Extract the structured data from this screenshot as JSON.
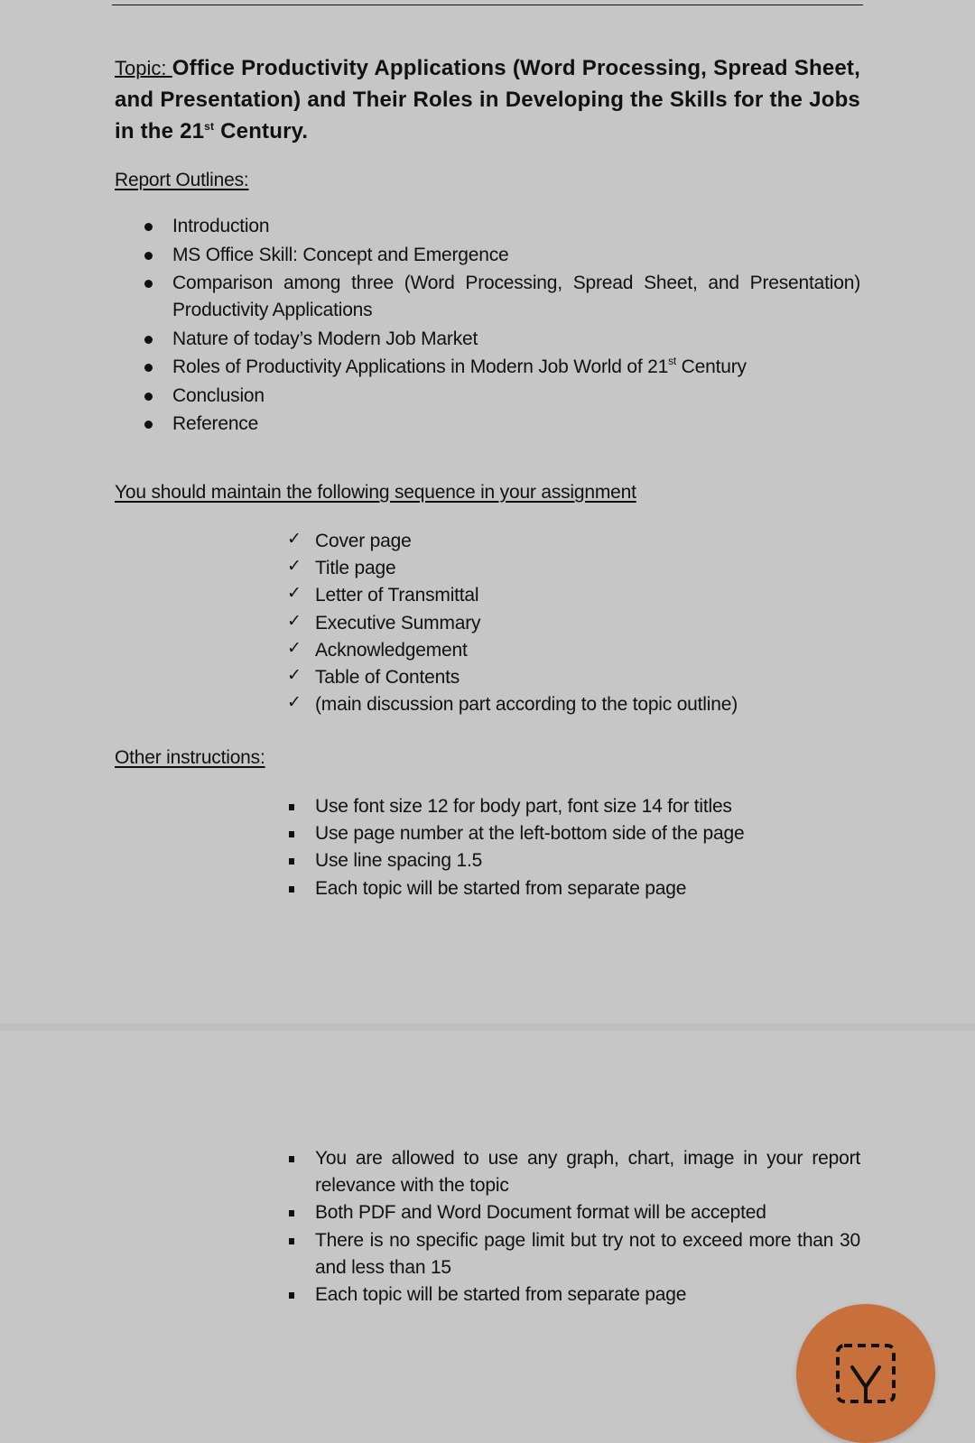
{
  "document": {
    "topic": {
      "label": "Topic: ",
      "title_pre": "Office Productivity Applications (Word Processing, Spread Sheet, and Presentation) and Their Roles in Developing the Skills for the Jobs in the 21",
      "title_sup": "st",
      "title_post": " Century."
    },
    "report_outlines": {
      "heading": "Report Outlines:",
      "items": [
        {
          "text": "Introduction"
        },
        {
          "text": "MS Office Skill: Concept and Emergence"
        },
        {
          "text": "Comparison among three (Word Processing, Spread Sheet, and Presentation) Productivity Applications"
        },
        {
          "text": "Nature of today’s Modern Job Market"
        },
        {
          "text": "Roles of Productivity Applications in Modern Job World of 21",
          "sup": "st",
          "after": " Century"
        },
        {
          "text": "Conclusion"
        },
        {
          "text": "Reference"
        }
      ]
    },
    "sequence": {
      "heading": "You should maintain the following sequence in your assignment",
      "check_glyph": "✓",
      "items": [
        "Cover page",
        "Title page",
        "Letter of Transmittal",
        "Executive Summary",
        "Acknowledgement",
        "Table of Contents",
        "(main discussion part according to the topic outline)"
      ]
    },
    "other_instructions": {
      "heading": "Other instructions:",
      "page1_items": [
        "Use font size 12 for body part, font size 14 for titles",
        "Use page number at the left-bottom side of the page",
        "Use line spacing 1.5",
        "Each topic will be started from separate page"
      ],
      "page2_items": [
        "You are allowed to use any graph, chart, image in your report relevance with the topic",
        "Both PDF and Word Document format will be accepted",
        "There is no specific page limit but try not to exceed more than 30 and less than 15",
        "Each topic will be started from separate page"
      ]
    }
  },
  "fab": {
    "icon": "scan-crop-icon",
    "color": "#c8703c"
  }
}
